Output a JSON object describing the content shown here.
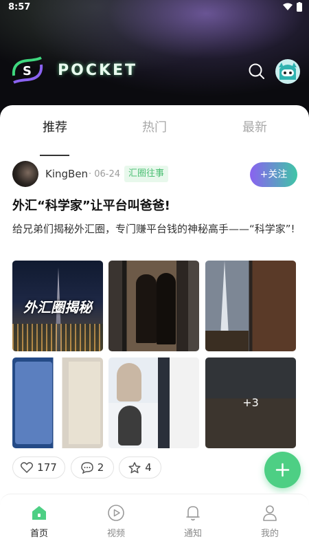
{
  "status": {
    "time": "8:57"
  },
  "header": {
    "logo_text": "POCKET",
    "logo_icon": "s-logo-icon",
    "search_icon": "search-icon"
  },
  "tabs": [
    {
      "label": "推荐",
      "active": true
    },
    {
      "label": "热门",
      "active": false
    },
    {
      "label": "最新",
      "active": false
    }
  ],
  "post": {
    "author": "KingBen",
    "date": "· 06-24",
    "tag": "汇圈往事",
    "follow_label": "+关注",
    "title": "外汇“科学家”让平台叫爸爸!",
    "body": "给兄弟们揭秘外汇圈，专门赚平台钱的神秘高手——“科学家”!",
    "images": [
      {
        "overlay": "外汇圈揭秘"
      },
      {
        "overlay": ""
      },
      {
        "overlay": ""
      },
      {
        "overlay": ""
      },
      {
        "overlay": ""
      },
      {
        "overlay": "+3"
      }
    ],
    "likes": "177",
    "comments": "2",
    "stars": "4"
  },
  "fab": {
    "icon": "plus-icon"
  },
  "nav": [
    {
      "label": "首页",
      "icon": "home-icon",
      "active": true
    },
    {
      "label": "视频",
      "icon": "play-icon",
      "active": false
    },
    {
      "label": "通知",
      "icon": "bell-icon",
      "active": false
    },
    {
      "label": "我的",
      "icon": "user-icon",
      "active": false
    }
  ],
  "colors": {
    "accent": "#4dcf84",
    "follow_start": "#8a62f0",
    "follow_end": "#3fc5a6",
    "tag_text": "#4cbf74"
  }
}
